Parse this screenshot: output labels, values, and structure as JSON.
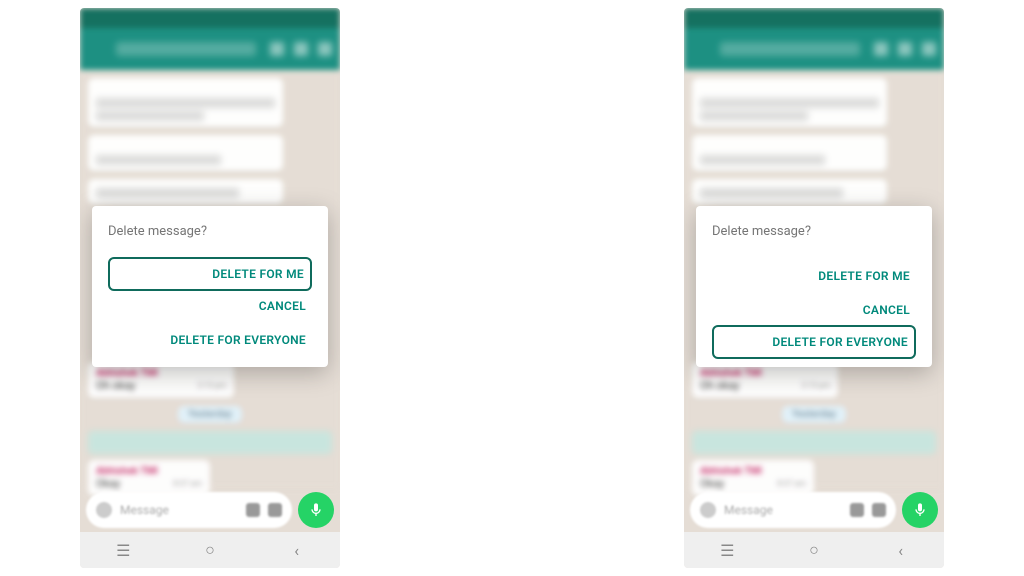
{
  "dialog": {
    "title": "Delete message?",
    "delete_for_me": "DELETE FOR ME",
    "cancel": "CANCEL",
    "delete_for_everyone": "DELETE FOR EVERYONE"
  },
  "chat": {
    "sender_a": "Abhishek TMI",
    "msg_a": "Oh okay",
    "ts_a": "2:13 pm",
    "date_chip": "Yesterday",
    "sender_b": "Abhishek TMI",
    "msg_b": "Okay",
    "ts_b": "8:37 am",
    "input_placeholder": "Message"
  },
  "colors": {
    "teal": "#128C7E",
    "action": "#00897b",
    "send": "#25d366"
  }
}
